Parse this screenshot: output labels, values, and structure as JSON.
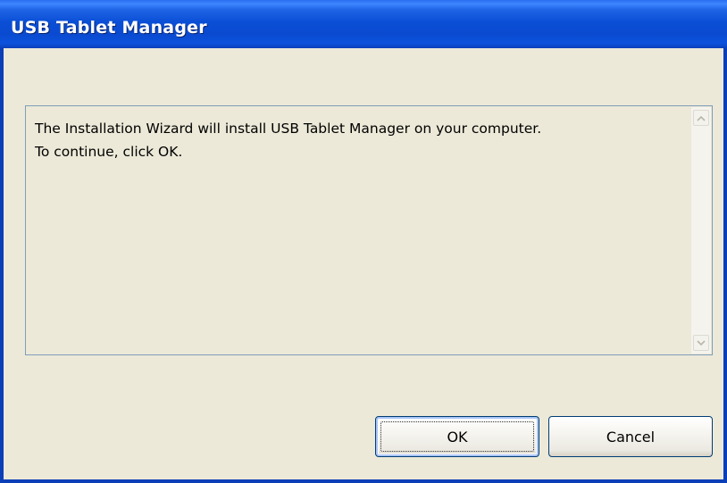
{
  "window": {
    "title": "USB Tablet Manager"
  },
  "message": {
    "text": "The Installation Wizard will install USB Tablet Manager on your computer.\nTo continue, click OK."
  },
  "buttons": {
    "ok_label": "OK",
    "cancel_label": "Cancel"
  },
  "colors": {
    "titlebar": "#0a4fd6",
    "dialog_background": "#ece9d8",
    "button_border": "#003c74"
  }
}
